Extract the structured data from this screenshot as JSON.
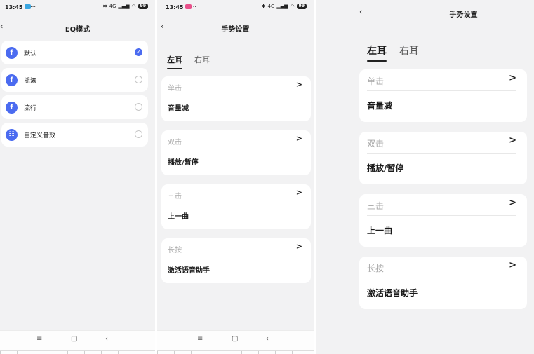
{
  "colors": {
    "accent": "#4b6bf0",
    "background": "#f2f2f3",
    "card": "#ffffff",
    "muted": "#a7a7a7"
  },
  "screen1": {
    "status": {
      "time": "13:45",
      "indicator": "⋯",
      "network": "4G",
      "battery": "99"
    },
    "title": "EQ模式",
    "back_icon": "‹",
    "items": [
      {
        "label": "默认",
        "icon": "f",
        "selected": true
      },
      {
        "label": "摇滚",
        "icon": "f",
        "selected": false
      },
      {
        "label": "流行",
        "icon": "f",
        "selected": false
      },
      {
        "label": "自定义音效",
        "icon": "☷",
        "selected": false
      }
    ],
    "check_mark": "✓"
  },
  "screen2": {
    "status": {
      "time": "13:45",
      "indicator": "⋯",
      "network": "4G",
      "battery": "99"
    },
    "title": "手势设置",
    "back_icon": "‹",
    "tabs": [
      "左耳",
      "右耳"
    ],
    "cards": [
      {
        "label": "单击",
        "value": "音量减"
      },
      {
        "label": "双击",
        "value": "播放/暂停"
      },
      {
        "label": "三击",
        "value": "上一曲"
      },
      {
        "label": "长按",
        "value": "激活语音助手"
      }
    ],
    "chevron": ">"
  },
  "screen3": {
    "title": "手势设置",
    "back_icon": "‹",
    "tabs": [
      "左耳",
      "右耳"
    ],
    "cards": [
      {
        "label": "单击",
        "value": "音量减"
      },
      {
        "label": "双击",
        "value": "播放/暂停"
      },
      {
        "label": "三击",
        "value": "上一曲"
      },
      {
        "label": "长按",
        "value": "激活语音助手"
      }
    ],
    "chevron": ">"
  },
  "navbar": {
    "menu": "≡",
    "home": "▢",
    "back": "‹"
  }
}
